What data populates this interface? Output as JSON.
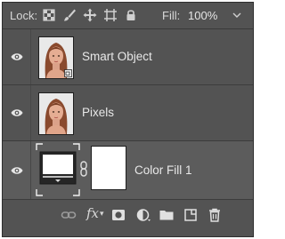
{
  "lockbar": {
    "lock_label": "Lock:",
    "fill_label": "Fill:",
    "fill_value": "100%",
    "icons": [
      "lock-transparent-pixels-icon",
      "lock-image-pixels-icon",
      "lock-position-icon",
      "lock-artboard-icon",
      "lock-all-icon",
      "chevron-down-icon"
    ]
  },
  "layers": [
    {
      "name": "Smart Object",
      "visible": true,
      "type": "smart-object"
    },
    {
      "name": "Pixels",
      "visible": true,
      "type": "pixel"
    },
    {
      "name": "Color Fill 1",
      "visible": true,
      "type": "fill",
      "selected": true
    }
  ],
  "toolbar": {
    "icons": [
      "link-layers-icon",
      "fx-icon",
      "add-mask-icon",
      "adjustment-layer-icon",
      "new-group-icon",
      "new-layer-icon",
      "delete-icon"
    ],
    "fx_label": "fx"
  },
  "colors": {
    "panel": "#535353",
    "selected_row": "#5c5c5c",
    "text": "#e8e8e8"
  }
}
